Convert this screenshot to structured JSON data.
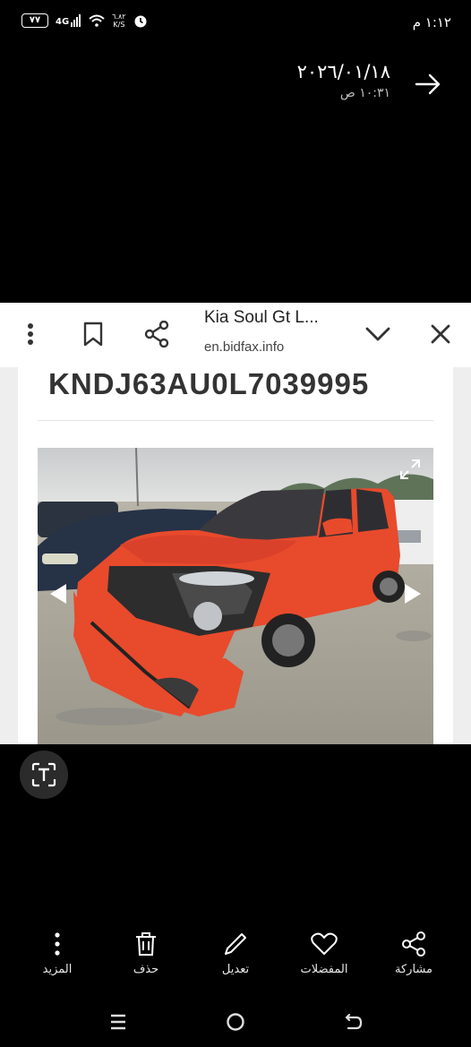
{
  "status_bar": {
    "time": "١:١٢ م",
    "battery": "٧٧",
    "network": "4G",
    "speed_value": "٦.٨٢",
    "speed_unit": "K/S"
  },
  "header": {
    "date": "٢٠٢٦/٠١/١٨",
    "time": "١٠:٣١ ص"
  },
  "browser": {
    "title": "Kia Soul Gt L...",
    "url": "en.bidfax.info"
  },
  "page": {
    "vin": "KNDJ63AU0L7039995"
  },
  "actions": [
    {
      "label": "المزيد",
      "icon": "more-vert-icon"
    },
    {
      "label": "حذف",
      "icon": "trash-icon"
    },
    {
      "label": "تعديل",
      "icon": "edit-pen-icon"
    },
    {
      "label": "المفضلات",
      "icon": "heart-icon"
    },
    {
      "label": "مشاركة",
      "icon": "share-icon"
    }
  ],
  "colors": {
    "background": "#000000",
    "car_body": "#e84a2c",
    "browser_bar": "#ffffff"
  }
}
